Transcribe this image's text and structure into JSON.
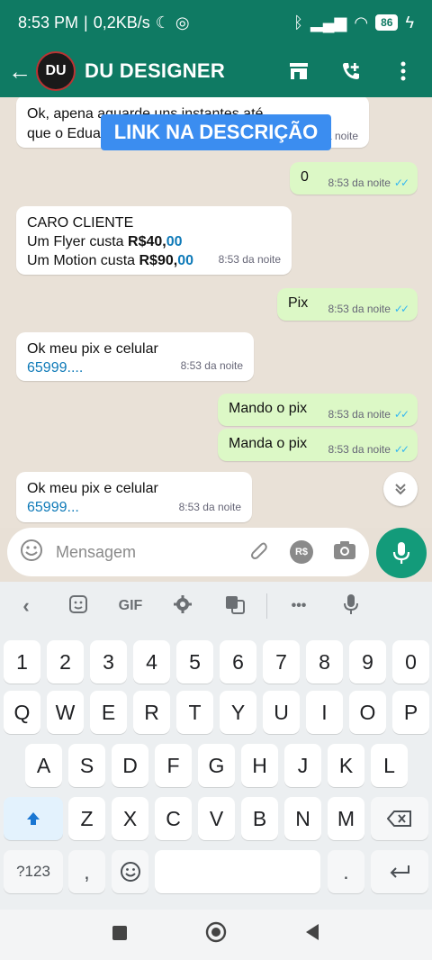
{
  "status": {
    "time": "8:53 PM",
    "network": "0,2KB/s",
    "battery": "86"
  },
  "header": {
    "title": "DU DESIGNER",
    "avatar_text": "DU",
    "colors": {
      "accent": "#0f7a63"
    }
  },
  "overlay": {
    "label": "LINK NA DESCRIÇÃO"
  },
  "messages": [
    {
      "text": "Ok, apena aguarde uns instantes até que o Eduardo ve",
      "time": "8:53 da noite"
    },
    {
      "text": "0",
      "time": "8:53 da noite"
    },
    {
      "line1": "CARO CLIENTE",
      "line2_prefix": "Um Flyer custa ",
      "line2_price": "R$40,",
      "line2_cents": "00",
      "line3_prefix": "Um Motion custa ",
      "line3_price": "R$90,",
      "line3_cents": "00",
      "time": "8:53 da noite"
    },
    {
      "text": "Pix",
      "time": "8:53 da noite"
    },
    {
      "line1": "Ok meu pix e celular",
      "line2": "65999....",
      "time": "8:53 da noite"
    },
    {
      "text": "Mando o pix",
      "time": "8:53 da noite"
    },
    {
      "text": "Manda o pix",
      "time": "8:53 da noite"
    },
    {
      "line1": "Ok meu pix e celular",
      "line2": "65999...",
      "time": "8:53 da noite"
    }
  ],
  "input": {
    "placeholder": "Mensagem",
    "currency_label": "R$"
  },
  "keyboard_toolbar": {
    "gif_label": "GIF",
    "more_label": "•••"
  },
  "keyboard": {
    "row_numbers": [
      "1",
      "2",
      "3",
      "4",
      "5",
      "6",
      "7",
      "8",
      "9",
      "0"
    ],
    "row1": [
      "Q",
      "W",
      "E",
      "R",
      "T",
      "Y",
      "U",
      "I",
      "O",
      "P"
    ],
    "row2": [
      "A",
      "S",
      "D",
      "F",
      "G",
      "H",
      "J",
      "K",
      "L"
    ],
    "row3": [
      "Z",
      "X",
      "C",
      "V",
      "B",
      "N",
      "M"
    ],
    "symbols_label": "?123",
    "comma": ",",
    "period": "."
  }
}
